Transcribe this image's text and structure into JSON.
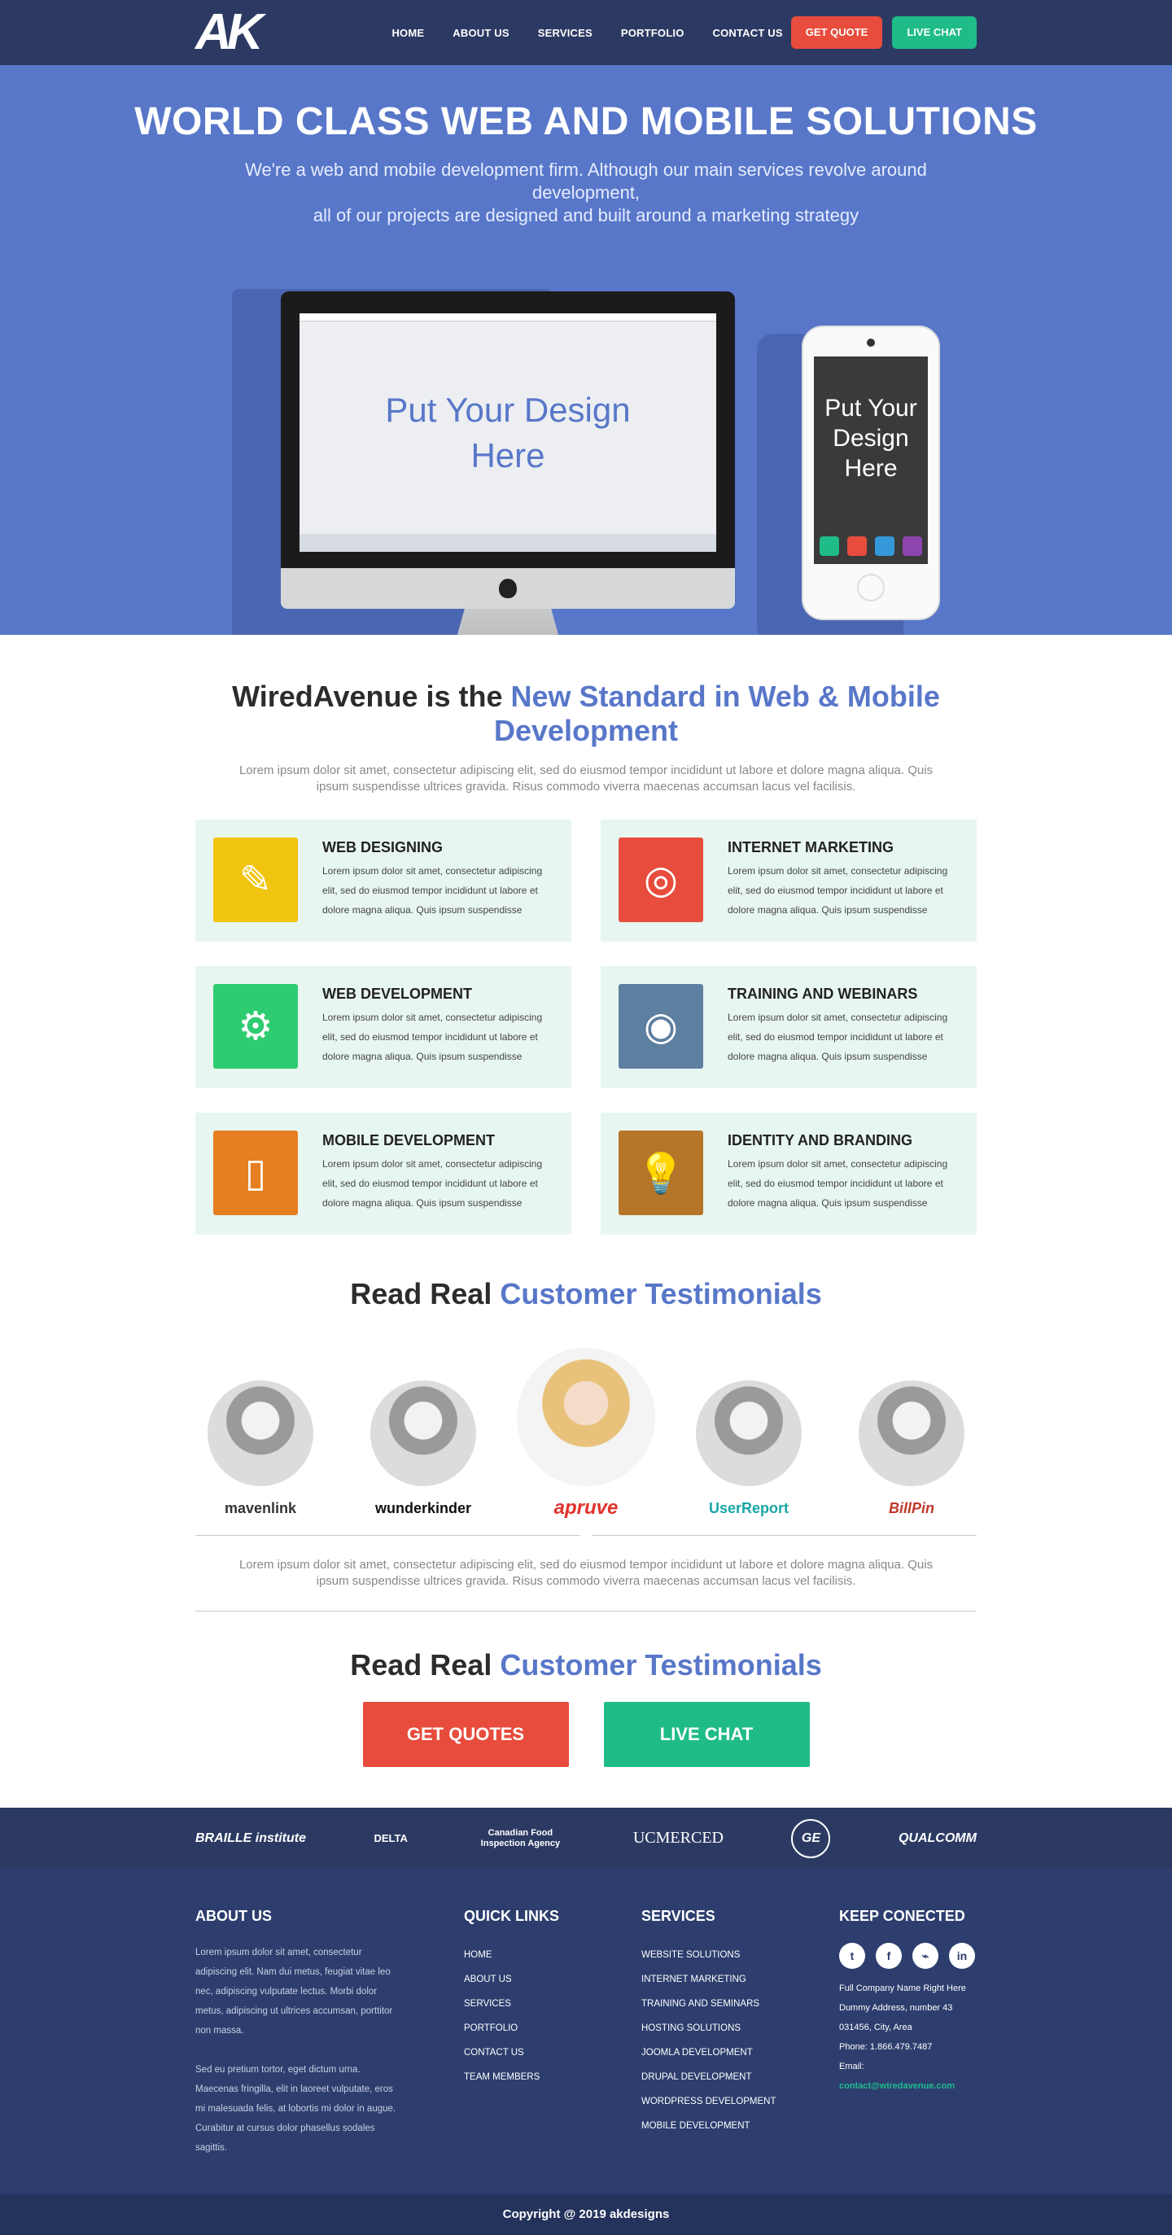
{
  "nav": {
    "logo": "AK",
    "links": [
      "HOME",
      "ABOUT US",
      "SERVICES",
      "PORTFOLIO",
      "CONTACT US"
    ],
    "quote_btn": "GET QUOTE",
    "chat_btn": "LIVE CHAT"
  },
  "hero": {
    "title": "WORLD CLASS WEB AND MOBILE SOLUTIONS",
    "subtitle_1": "We're a web and mobile development firm. Although our main services revolve around development,",
    "subtitle_2": "all of our projects are designed and built around a marketing strategy",
    "monitor_text_1": "Put Your Design",
    "monitor_text_2": "Here",
    "phone_text_1": "Put Your",
    "phone_text_2": "Design",
    "phone_text_3": "Here"
  },
  "services": {
    "title_plain": "WiredAvenue is the ",
    "title_hl": "New Standard in Web & Mobile Development",
    "lead": "Lorem ipsum dolor sit amet, consectetur adipiscing elit, sed do eiusmod tempor incididunt ut labore et dolore magna aliqua. Quis ipsum suspendisse ultrices gravida. Risus commodo viverra maecenas accumsan lacus vel facilisis.",
    "items": [
      {
        "title": "WEB DESIGNING",
        "text": "Lorem ipsum dolor sit amet, consectetur adipiscing elit, sed do eiusmod tempor incididunt ut labore et dolore magna aliqua. Quis ipsum suspendisse",
        "icon": "pencil-icon",
        "color": "#f1c40f"
      },
      {
        "title": "INTERNET MARKETING",
        "text": "Lorem ipsum dolor sit amet, consectetur adipiscing elit, sed do eiusmod tempor incididunt ut labore et dolore magna aliqua. Quis ipsum suspendisse",
        "icon": "target-icon",
        "color": "#e74c3c"
      },
      {
        "title": "WEB DEVELOPMENT",
        "text": "Lorem ipsum dolor sit amet, consectetur adipiscing elit, sed do eiusmod tempor incididunt ut labore et dolore magna aliqua. Quis ipsum suspendisse",
        "icon": "wrench-icon",
        "color": "#2ecc71"
      },
      {
        "title": "TRAINING AND WEBINARS",
        "text": "Lorem ipsum dolor sit amet, consectetur adipiscing elit, sed do eiusmod tempor incididunt ut labore et dolore magna aliqua. Quis ipsum suspendisse",
        "icon": "lifebuoy-icon",
        "color": "#5d7fa0"
      },
      {
        "title": "MOBILE DEVELOPMENT",
        "text": "Lorem ipsum dolor sit amet, consectetur adipiscing elit, sed do eiusmod tempor incididunt ut labore et dolore magna aliqua. Quis ipsum suspendisse",
        "icon": "smartphone-icon",
        "color": "#e67e22"
      },
      {
        "title": "IDENTITY AND BRANDING",
        "text": "Lorem ipsum dolor sit amet, consectetur adipiscing elit, sed do eiusmod tempor incididunt ut labore et dolore magna aliqua. Quis ipsum suspendisse",
        "icon": "lightbulb-icon",
        "color": "#b5762a"
      }
    ]
  },
  "testimonials": {
    "title_plain": "Read Real ",
    "title_hl": "Customer Testimonials",
    "brands": [
      "mavenlink",
      "wunderkinder",
      "apruve",
      "UserReport",
      "BillPin"
    ],
    "brand_colors": [
      "#333333",
      "#111111",
      "#e0322b",
      "#1aa6a6",
      "#c0392b"
    ],
    "quote": "Lorem ipsum dolor sit amet, consectetur adipiscing elit, sed do eiusmod tempor incididunt ut labore et dolore magna aliqua. Quis ipsum suspendisse ultrices gravida. Risus commodo viverra maecenas accumsan lacus vel facilisis."
  },
  "cta": {
    "title_plain": "Read Real ",
    "title_hl": "Customer Testimonials",
    "quotes_btn": "GET QUOTES",
    "chat_btn": "LIVE CHAT"
  },
  "logos": [
    "BRAILLE institute",
    "DELTA",
    "Canadian Food Inspection Agency",
    "UCMERCED",
    "GE",
    "QUALCOMM"
  ],
  "footer": {
    "about_title": "ABOUT US",
    "about_p1": "Lorem ipsum dolor sit amet, consectetur adipiscing elit. Nam dui metus, feugiat vitae leo nec, adipiscing vulputate lectus. Morbi dolor metus, adipiscing ut ultrices accumsan, porttitor non massa.",
    "about_p2": "Sed eu pretium tortor, eget dictum urna. Maecenas fringilla, elit in laoreet vulputate, eros mi malesuada felis, at lobortis mi dolor in augue. Curabitur at cursus dolor phasellus sodales sagittis.",
    "links_title": "QUICK LINKS",
    "links": [
      "HOME",
      "ABOUT US",
      "SERVICES",
      "PORTFOLIO",
      "CONTACT US",
      "TEAM MEMBERS"
    ],
    "services_title": "SERVICES",
    "services": [
      "WEBSITE SOLUTIONS",
      "INTERNET MARKETING",
      "TRAINING AND SEMINARS",
      "HOSTING SOLUTIONS",
      "JOOMLA DEVELOPMENT",
      "DRUPAL DEVELOPMENT",
      "WORDPRESS DEVELOPMENT",
      "MOBILE DEVELOPMENT"
    ],
    "connect_title": "KEEP CONECTED",
    "social": [
      "twitter-icon",
      "facebook-icon",
      "rss-icon",
      "linkedin-icon"
    ],
    "address_1": "Full Company Name Right Here",
    "address_2": "Dummy Address, number 43",
    "address_3": "031456, City, Area",
    "phone": "Phone: 1.866.479.7487",
    "email_label": "Email: ",
    "email": "contact@wiredavenue.com"
  },
  "copyright": "Copyright @ 2019 akdesigns"
}
